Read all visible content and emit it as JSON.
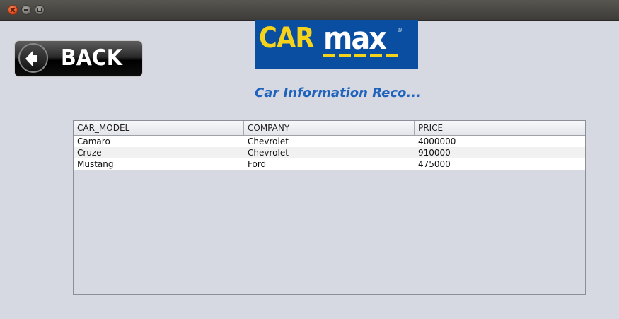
{
  "window": {
    "buttons": {
      "close": "close",
      "minimize": "minimize",
      "maximize": "maximize"
    }
  },
  "back_button": {
    "label": "BACK"
  },
  "logo": {
    "part1": "CAR",
    "part2": "max",
    "registered": "®",
    "colors": {
      "background": "#0a4ea1",
      "car": "#f5d31a",
      "max": "#ffffff"
    }
  },
  "heading": "Car Information Reco...",
  "table": {
    "columns": [
      "CAR_MODEL",
      "COMPANY",
      "PRICE"
    ],
    "rows": [
      [
        "Camaro",
        "Chevrolet",
        "4000000"
      ],
      [
        "Cruze",
        "Chevrolet",
        "910000"
      ],
      [
        "Mustang",
        "Ford",
        "475000"
      ]
    ]
  }
}
